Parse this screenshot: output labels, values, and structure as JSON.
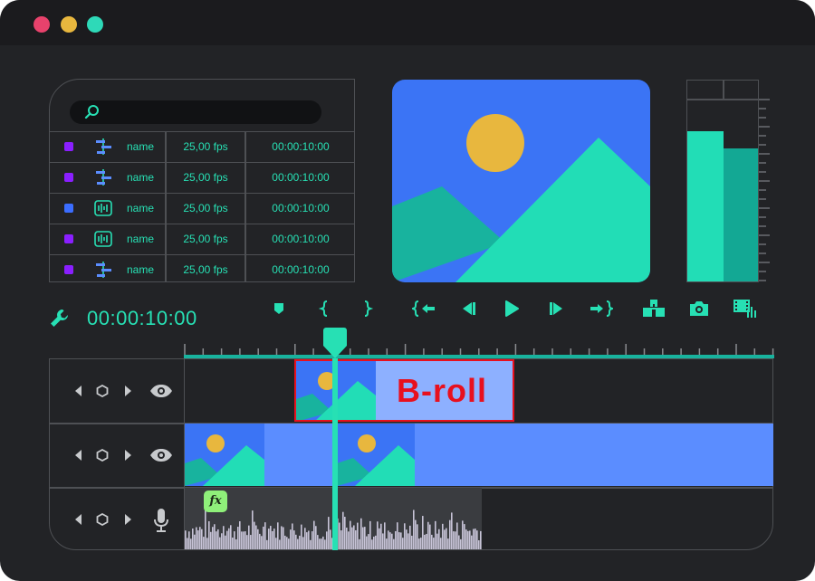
{
  "window": {
    "traffic_lights": [
      "#e8426c",
      "#e8b73e",
      "#2ed9b8"
    ]
  },
  "media_panel": {
    "search_icon": "search-icon",
    "rows": [
      {
        "color": "#8a1fff",
        "icon": "sliders-icon",
        "name": "name",
        "fps": "25,00 fps",
        "duration": "00:00:10:00"
      },
      {
        "color": "#8a1fff",
        "icon": "sliders-icon",
        "name": "name",
        "fps": "25,00 fps",
        "duration": "00:00:10:00"
      },
      {
        "color": "#3b6dff",
        "icon": "audio-wave-icon",
        "name": "name",
        "fps": "25,00 fps",
        "duration": "00:00:10:00"
      },
      {
        "color": "#8a1fff",
        "icon": "audio-wave-icon",
        "name": "name",
        "fps": "25,00 fps",
        "duration": "00:00:10:00"
      },
      {
        "color": "#8a1fff",
        "icon": "sliders-icon",
        "name": "name",
        "fps": "25,00 fps",
        "duration": "00:00:10:00"
      }
    ]
  },
  "preview": {
    "icon": "image-placeholder-icon"
  },
  "audio_meter": {
    "levels": [
      0.82,
      0.73
    ]
  },
  "transport": {
    "timecode": "00:00:10:00",
    "buttons": [
      "marker-icon",
      "mark-in-icon",
      "mark-out-icon",
      "go-to-in-icon",
      "step-back-icon",
      "play-icon",
      "step-forward-icon",
      "go-to-out-icon",
      "overwrite-icon",
      "snapshot-icon",
      "film-settings-icon"
    ]
  },
  "timeline": {
    "clip_label": "B-roll",
    "fx_label": "fx",
    "tracks": [
      {
        "type": "video",
        "visibility_icon": "eye-icon"
      },
      {
        "type": "video",
        "visibility_icon": "eye-icon"
      },
      {
        "type": "audio",
        "visibility_icon": "microphone-icon"
      }
    ]
  },
  "colors": {
    "accent": "#27e0b4",
    "clip_blue": "#5b8dff",
    "clip_highlight": "#e8101e",
    "preview_sky": "#3b74f5",
    "sun": "#e8b73e"
  }
}
